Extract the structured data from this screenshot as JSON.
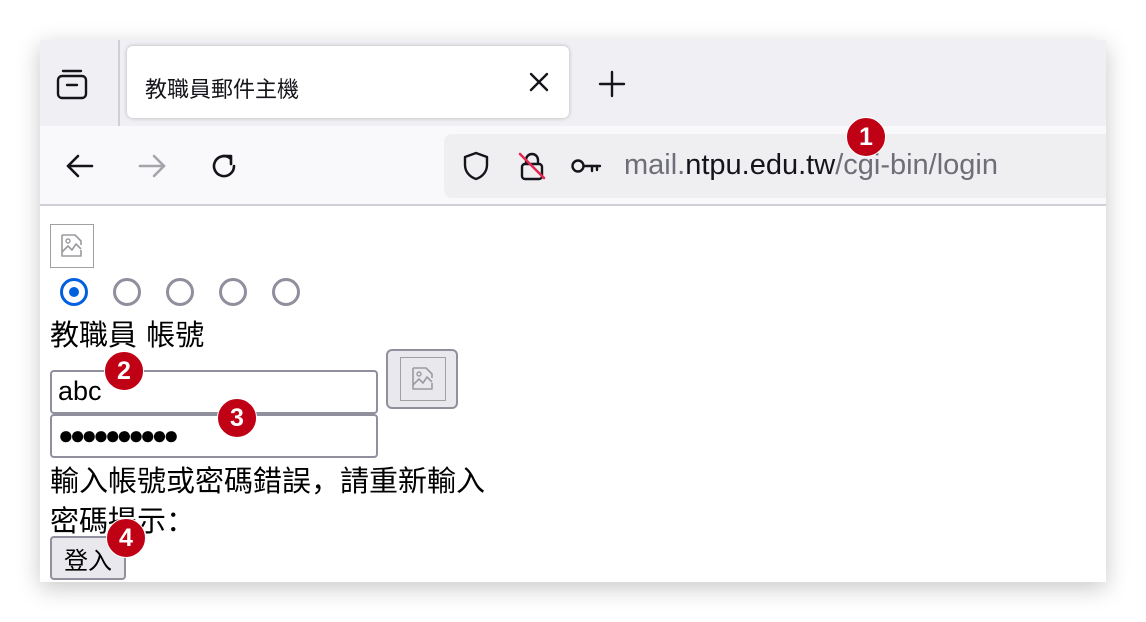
{
  "browser": {
    "tab": {
      "title": "教職員郵件主機"
    },
    "url": {
      "scheme": "mail.",
      "host": "ntpu.edu.tw",
      "path": "/cgi-bin/login"
    }
  },
  "page": {
    "account_label": "教職員 帳號",
    "username_value": "abc",
    "password_dots": "●●●●●●●●●●",
    "error_message": "輸入帳號或密碼錯誤，請重新輸入",
    "password_hint_label": "密碼提示：",
    "login_button": "登入",
    "radio_selected_index": 0
  },
  "annotations": [
    "1",
    "2",
    "3",
    "4"
  ],
  "colors": {
    "accent": "#0060df",
    "badge": "#c00014"
  },
  "icons": [
    "tab-list-icon",
    "close-icon",
    "plus-icon",
    "back-arrow-icon",
    "forward-arrow-icon",
    "reload-icon",
    "shield-icon",
    "insecure-lock-icon",
    "key-icon",
    "broken-image-icon"
  ]
}
